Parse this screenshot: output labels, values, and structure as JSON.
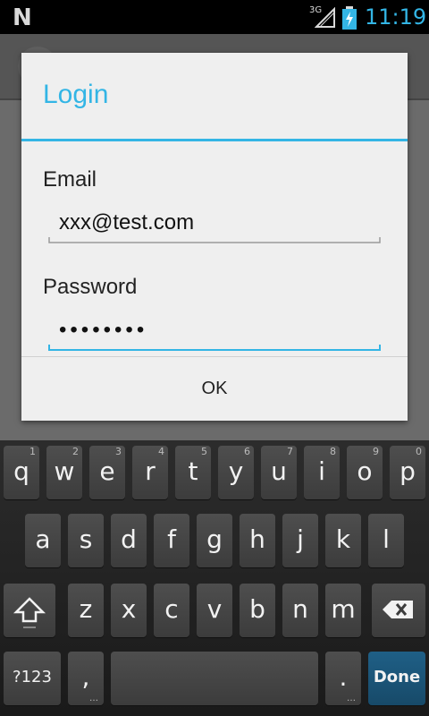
{
  "status_bar": {
    "carrier_glyph": "N",
    "network": "3G",
    "time": "11:19"
  },
  "dialog": {
    "title": "Login",
    "email_label": "Email",
    "email_value": "xxx@test.com",
    "password_label": "Password",
    "password_value": "••••••••",
    "ok_label": "OK"
  },
  "keyboard": {
    "row1": [
      {
        "label": "q",
        "hint": "1"
      },
      {
        "label": "w",
        "hint": "2"
      },
      {
        "label": "e",
        "hint": "3"
      },
      {
        "label": "r",
        "hint": "4"
      },
      {
        "label": "t",
        "hint": "5"
      },
      {
        "label": "y",
        "hint": "6"
      },
      {
        "label": "u",
        "hint": "7"
      },
      {
        "label": "i",
        "hint": "8"
      },
      {
        "label": "o",
        "hint": "9"
      },
      {
        "label": "p",
        "hint": "0"
      }
    ],
    "row2": [
      "a",
      "s",
      "d",
      "f",
      "g",
      "h",
      "j",
      "k",
      "l"
    ],
    "row3": [
      "z",
      "x",
      "c",
      "v",
      "b",
      "n",
      "m"
    ],
    "symbols_label": "?123",
    "comma_label": ",",
    "period_label": ".",
    "done_label": "Done",
    "more_dots": "…"
  },
  "colors": {
    "accent": "#33b5e5",
    "dialog_bg": "#efefef",
    "done_key": "#1f5f86"
  }
}
